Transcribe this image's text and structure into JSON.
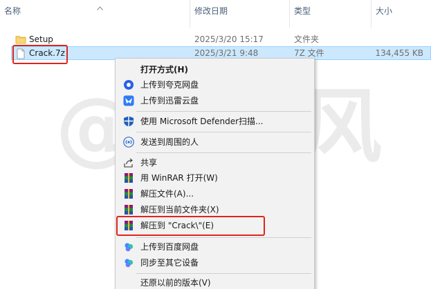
{
  "columns": {
    "name": "名称",
    "date": "修改日期",
    "type": "类型",
    "size": "大小"
  },
  "files": [
    {
      "name": "Setup",
      "date": "2025/3/20 15:17",
      "type": "文件夹",
      "size": "",
      "icon": "folder-icon"
    },
    {
      "name": "Crack.7z",
      "date": "2025/3/21 9:48",
      "type": "7Z 文件",
      "size": "134,455 KB",
      "icon": "archive-icon",
      "selected": true
    }
  ],
  "watermark": "@源于风",
  "context_menu": {
    "open_with": "打开方式(H)",
    "upload_quark": "上传到夸克网盘",
    "upload_xunlei": "上传到迅雷云盘",
    "defender_scan": "使用 Microsoft Defender扫描...",
    "send_nearby": "发送到周围的人",
    "share": "共享",
    "open_winrar": "用 WinRAR 打开(W)",
    "extract_files": "解压文件(A)...",
    "extract_here": "解压到当前文件夹(X)",
    "extract_to_folder": "解压到 \"Crack\\\"(E)",
    "upload_baidu": "上传到百度网盘",
    "sync_devices": "同步至其它设备",
    "restore_versions": "还原以前的版本(V)"
  },
  "colors": {
    "selection": "#cce8ff",
    "highlight_box": "#e0241b",
    "menu_bg": "#f2f2f2"
  }
}
